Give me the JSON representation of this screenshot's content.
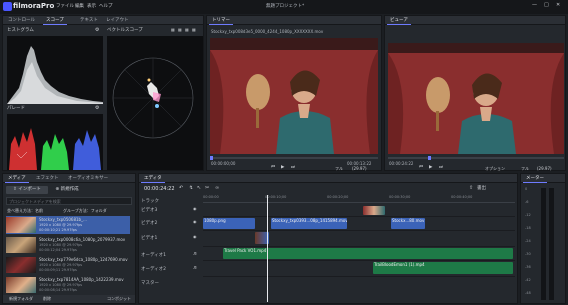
{
  "app": {
    "logo": "filmoraPro",
    "menu": [
      "ファイル",
      "編集",
      "表示",
      "ヘルプ"
    ],
    "project_title": "無題プロジェクト*"
  },
  "scopes_panel": {
    "tabs": [
      "コントロール",
      "スコープ",
      "テキスト",
      "レイアウト"
    ],
    "histogram_label": "ヒストグラム",
    "vectorscope_label": "ベクトルスコープ",
    "parade_label": "パレード"
  },
  "trimmer": {
    "title": "トリマー",
    "filename": "Stockxy_txp008d3e5_0000_4244_1080p_XXXXXXX.mov",
    "timecode": "00:00:00;00",
    "end_timecode": "00:00:13:22",
    "fit_label": "フル",
    "fps_label": "(29.97)"
  },
  "viewer": {
    "title": "ビューア",
    "timecode": "00:00:24:22",
    "options_label": "オプション",
    "fit_label": "フル",
    "fps_label": "(29.97)"
  },
  "media": {
    "tabs": [
      "メディア",
      "エフェクト",
      "オーディオミキサー"
    ],
    "import_label": "インポート",
    "new_label": "新規作成",
    "search_placeholder": "プロジェクトメディアを検索",
    "sort_label": "並べ替え方法：名前",
    "group_label": "グループ方法：フォルダ",
    "new_folder_label": "新規フォルダ",
    "delete_label": "削除",
    "composite_label": "コンポジット",
    "items": [
      {
        "name": "Stockxy_txp050681b_...",
        "meta1": "1920 x 1080 @ 29.97fps",
        "meta2": "00:00:10;21 29.97fps"
      },
      {
        "name": "Stockxy_txp0008c6a_1080p_2079937.mov",
        "meta1": "1920 x 1080 @ 29.97fps",
        "meta2": "00:00:12;04 29.97fps"
      },
      {
        "name": "Stockxy_txp779e6dca_1080p_1247690.mov",
        "meta1": "1920 x 1080 @ 29.97fps",
        "meta2": "00:00:09;11 29.97fps"
      },
      {
        "name": "Stockxy_txp7814AA_1080p_1422239.mov",
        "meta1": "1920 x 1080 @ 29.97fps",
        "meta2": "00:00:08;14 29.97fps"
      }
    ]
  },
  "editor": {
    "title": "エディタ",
    "timecode": "00:00:24:22",
    "export_label": "書出",
    "ruler": [
      "00:00:00",
      "00:00:10;00",
      "00:00:20;00",
      "00:00:30;00",
      "00:00:40;00"
    ],
    "tracks": [
      {
        "label": "トラック"
      },
      {
        "label": "ビデオ3"
      },
      {
        "label": "ビデオ2"
      },
      {
        "label": "ビデオ1"
      },
      {
        "label": "オーディオ1"
      },
      {
        "label": "オーディオ2"
      },
      {
        "label": "マスター"
      }
    ],
    "clips": {
      "png": "1080p.png",
      "mov1": "Stockxy_txp0393...08p_1415894.mov",
      "mov2": "Stockx...80.mov",
      "audio1": "Travel Pack VO1.mp4",
      "audio2": "TrailBloodEmon1 (1).mp4"
    }
  },
  "meter": {
    "title": "メーター",
    "scale": [
      "0",
      "-6",
      "-12",
      "-18",
      "-24",
      "-30",
      "-36",
      "-42",
      "-48"
    ]
  },
  "colors": {
    "accent": "#6e7bff",
    "video_clip": "#3b63b8",
    "audio_clip": "#1e7a47"
  }
}
